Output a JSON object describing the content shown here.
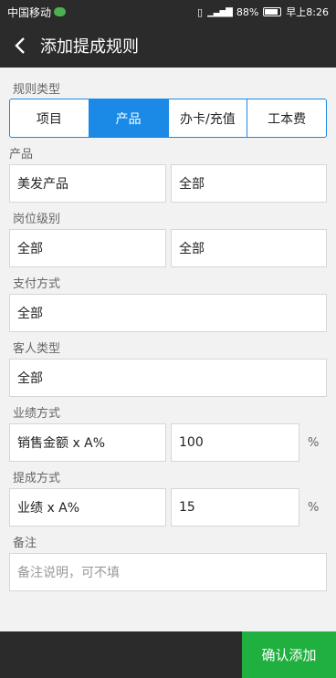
{
  "status_bar": {
    "carrier": "中国移动",
    "battery": "88%",
    "time": "早上8:26"
  },
  "header": {
    "title": "添加提成规则"
  },
  "rule_type": {
    "label": "规则类型",
    "options": [
      "项目",
      "产品",
      "办卡/充值",
      "工本费"
    ],
    "selected": "产品"
  },
  "product": {
    "label": "产品",
    "category": "美发产品",
    "item": "全部"
  },
  "position": {
    "label": "岗位级别",
    "post": "全部",
    "level": "全部"
  },
  "payment": {
    "label": "支付方式",
    "value": "全部"
  },
  "customer": {
    "label": "客人类型",
    "value": "全部"
  },
  "performance": {
    "label": "业绩方式",
    "formula": "销售金额 x A%",
    "value": "100",
    "unit": "%"
  },
  "commission": {
    "label": "提成方式",
    "formula": "业绩 x A%",
    "value": "15",
    "unit": "%"
  },
  "remark": {
    "label": "备注",
    "placeholder": "备注说明，可不填"
  },
  "footer": {
    "confirm_label": "确认添加"
  },
  "colors": {
    "accent": "#1a8ae6",
    "confirm": "#20b040",
    "bar": "#2b2b2b"
  }
}
